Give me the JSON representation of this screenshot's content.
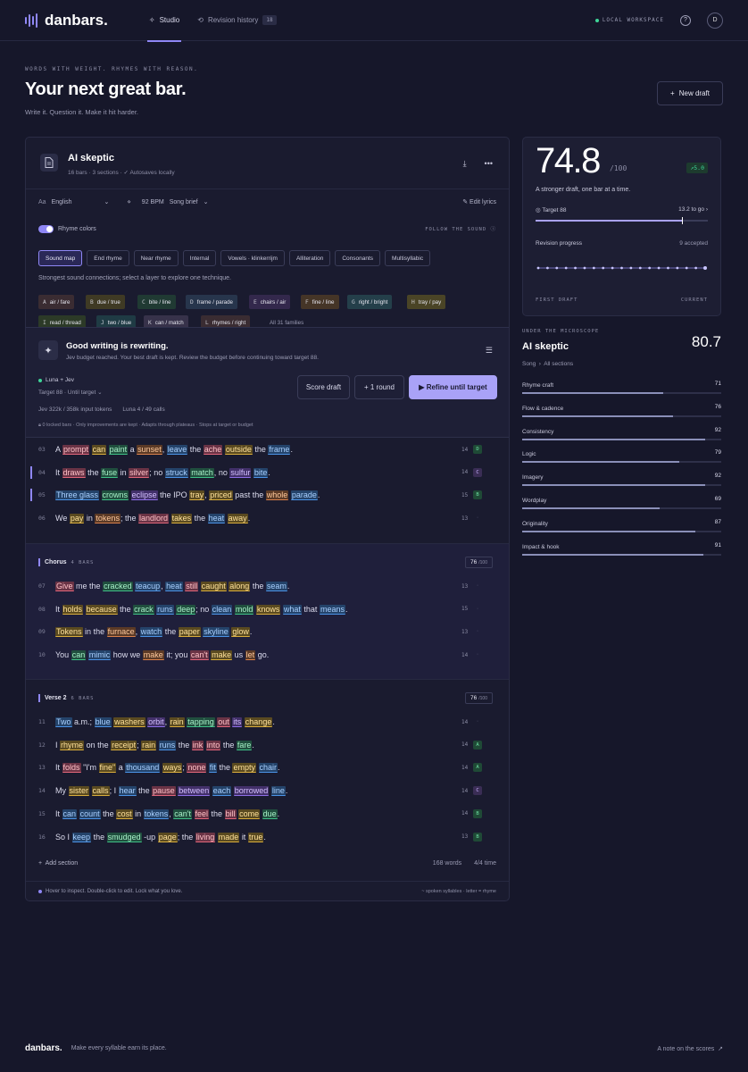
{
  "nav": {
    "logo": "danbars.",
    "tabs": [
      {
        "label": "Studio"
      },
      {
        "label": "Revision history",
        "count": "18"
      }
    ],
    "workspace": "LOCAL WORKSPACE",
    "help": "?",
    "avatar": "D"
  },
  "hero": {
    "eyebrow": "WORDS WITH WEIGHT. RHYMES WITH REASON.",
    "title": "Your next great bar.",
    "subtitle": "Write it. Question it. Make it hit harder.",
    "new_draft": "New draft"
  },
  "editor": {
    "title": "AI skeptic",
    "meta_bars": "16 bars",
    "meta_sections": "3 sections",
    "meta_save": "Autosaves locally",
    "language_label": "Aa",
    "language": "English",
    "bpm": "92 BPM",
    "brief": "Song brief",
    "edit_lyrics": "Edit lyrics",
    "rhyme_colors": "Rhyme colors",
    "follow": "FOLLOW THE SOUND",
    "chips": [
      "Sound map",
      "End rhyme",
      "Near rhyme",
      "Internal",
      "Vowels · klinkerrijm",
      "Alliteration",
      "Consonants",
      "Multisyllabic"
    ],
    "chip_hint": "Strongest sound connections; select a layer to explore one technique.",
    "families": [
      {
        "key": "A",
        "label": "air / fare"
      },
      {
        "key": "B",
        "label": "due / true"
      },
      {
        "key": "C",
        "label": "bite / line"
      },
      {
        "key": "D",
        "label": "frame / parade"
      },
      {
        "key": "E",
        "label": "chairs / air"
      },
      {
        "key": "F",
        "label": "fine / line"
      },
      {
        "key": "G",
        "label": "right / bright"
      },
      {
        "key": "H",
        "label": "tray / pay"
      },
      {
        "key": "I",
        "label": "read / thread"
      },
      {
        "key": "J",
        "label": "two / blue"
      },
      {
        "key": "K",
        "label": "can / match"
      },
      {
        "key": "L",
        "label": "rhymes / right"
      }
    ],
    "families_all": "All 31 families"
  },
  "panel": {
    "title": "Good writing is rewriting.",
    "subtitle": "Jev budget reached. Your best draft is kept. Review the budget before continuing toward target 88.",
    "model": "Luna + Jev",
    "target": "Target 88",
    "until": "Until target",
    "tokens": "Jev 322k / 358k input tokens",
    "calls": "Luna 4 / 49 calls",
    "locks": "0 locked bars",
    "rule1": "Only improvements are kept",
    "rule2": "Adapts through plateaus · Stops at target or budget",
    "score_btn": "Score draft",
    "round_btn": "1 round",
    "refine_btn": "Refine until target"
  },
  "verse1": [
    {
      "n": "03",
      "syl": "14",
      "scheme": "D",
      "words": [
        [
          "A",
          -1
        ],
        [
          "prompt",
          0
        ],
        [
          "can",
          1
        ],
        [
          "paint",
          2
        ],
        [
          "a",
          -1
        ],
        [
          "sunset",
          5
        ],
        [
          ",",
          -1
        ],
        [
          "leave",
          3
        ],
        [
          "the",
          -1
        ],
        [
          "ache",
          0
        ],
        [
          "outside",
          1
        ],
        [
          "the",
          -1
        ],
        [
          "frame",
          3
        ],
        [
          ".",
          -1
        ]
      ]
    },
    {
      "n": "04",
      "syl": "14",
      "scheme": "C",
      "mark": true,
      "words": [
        [
          "It",
          -1
        ],
        [
          "draws",
          0
        ],
        [
          "the",
          -1
        ],
        [
          "fuse",
          2
        ],
        [
          "in",
          -1
        ],
        [
          "silver",
          0
        ],
        [
          ";",
          -1
        ],
        [
          "no",
          -1
        ],
        [
          "struck",
          3
        ],
        [
          "match",
          2
        ],
        [
          ",",
          -1
        ],
        [
          "no",
          -1
        ],
        [
          "sulfur",
          4
        ],
        [
          "bite",
          3
        ],
        [
          ".",
          -1
        ]
      ]
    },
    {
      "n": "05",
      "syl": "15",
      "scheme": "B",
      "mark": true,
      "words": [
        [
          "Three glass",
          3
        ],
        [
          "crowns",
          2
        ],
        [
          "eclipse",
          4
        ],
        [
          "the IPO",
          -1
        ],
        [
          "tray",
          1
        ],
        [
          ",",
          -1
        ],
        [
          "priced",
          1
        ],
        [
          "past",
          -1
        ],
        [
          "the",
          -1
        ],
        [
          "whole",
          5
        ],
        [
          "parade",
          3
        ],
        [
          ".",
          -1
        ]
      ]
    },
    {
      "n": "06",
      "syl": "13",
      "scheme": "",
      "words": [
        [
          "We",
          -1
        ],
        [
          "pay",
          1
        ],
        [
          "in",
          -1
        ],
        [
          "tokens",
          5
        ],
        [
          ";",
          -1
        ],
        [
          "the",
          -1
        ],
        [
          "landlord",
          0
        ],
        [
          "takes",
          1
        ],
        [
          "the",
          -1
        ],
        [
          "heat",
          3
        ],
        [
          "away",
          1
        ],
        [
          ".",
          -1
        ]
      ]
    }
  ],
  "chorus": {
    "name": "Chorus",
    "count": "4 BARS",
    "score": "76",
    "max": "/100",
    "bars": [
      {
        "n": "07",
        "syl": "13",
        "scheme": "",
        "words": [
          [
            "Give",
            0
          ],
          [
            "me the",
            -1
          ],
          [
            "cracked",
            2
          ],
          [
            "teacup",
            3
          ],
          [
            ",",
            -1
          ],
          [
            "heat",
            3
          ],
          [
            "still",
            0
          ],
          [
            "caught",
            1
          ],
          [
            "along",
            1
          ],
          [
            "the",
            -1
          ],
          [
            "seam",
            3
          ],
          [
            ".",
            -1
          ]
        ]
      },
      {
        "n": "08",
        "syl": "15",
        "scheme": "",
        "words": [
          [
            "It",
            -1
          ],
          [
            "holds",
            1
          ],
          [
            "because",
            1
          ],
          [
            "the",
            -1
          ],
          [
            "crack",
            2
          ],
          [
            "runs",
            3
          ],
          [
            "deep",
            2
          ],
          [
            ";",
            -1
          ],
          [
            "no",
            -1
          ],
          [
            "clean",
            3
          ],
          [
            "mold",
            2
          ],
          [
            "knows",
            1
          ],
          [
            "what",
            3
          ],
          [
            "that",
            -1
          ],
          [
            "means",
            3
          ],
          [
            ".",
            -1
          ]
        ]
      },
      {
        "n": "09",
        "syl": "13",
        "scheme": "",
        "words": [
          [
            "Tokens",
            1
          ],
          [
            "in",
            -1
          ],
          [
            "the",
            -1
          ],
          [
            "furnace",
            5
          ],
          [
            ",",
            -1
          ],
          [
            "watch",
            3
          ],
          [
            "the",
            -1
          ],
          [
            "paper",
            1
          ],
          [
            "skyline",
            3
          ],
          [
            "glow",
            1
          ],
          [
            ".",
            -1
          ]
        ]
      },
      {
        "n": "10",
        "syl": "14",
        "scheme": "",
        "words": [
          [
            "You",
            -1
          ],
          [
            "can",
            2
          ],
          [
            "mimic",
            3
          ],
          [
            "how we",
            -1
          ],
          [
            "make",
            5
          ],
          [
            "it; you",
            -1
          ],
          [
            "can't",
            0
          ],
          [
            "make",
            1
          ],
          [
            "us",
            -1
          ],
          [
            "let",
            5
          ],
          [
            "go.",
            -1
          ]
        ]
      }
    ]
  },
  "verse2": {
    "name": "Verse 2",
    "count": "6 BARS",
    "score": "76",
    "max": "/100",
    "bars": [
      {
        "n": "11",
        "syl": "14",
        "scheme": "",
        "words": [
          [
            "Two",
            3
          ],
          [
            "a.m.;",
            -1
          ],
          [
            "blue",
            3
          ],
          [
            "washers",
            1
          ],
          [
            "orbit",
            4
          ],
          [
            ",",
            -1
          ],
          [
            "rain",
            1
          ],
          [
            "tapping",
            2
          ],
          [
            "out",
            0
          ],
          [
            "its",
            4
          ],
          [
            "change",
            1
          ],
          [
            ".",
            -1
          ]
        ]
      },
      {
        "n": "12",
        "syl": "14",
        "scheme": "A",
        "words": [
          [
            "I",
            -1
          ],
          [
            "rhyme",
            1
          ],
          [
            "on the",
            -1
          ],
          [
            "receipt",
            1
          ],
          [
            ";",
            -1
          ],
          [
            "rain",
            1
          ],
          [
            "runs",
            3
          ],
          [
            "the",
            -1
          ],
          [
            "ink",
            0
          ],
          [
            "into",
            0
          ],
          [
            "the",
            -1
          ],
          [
            "fare",
            2
          ],
          [
            ".",
            -1
          ]
        ]
      },
      {
        "n": "13",
        "syl": "14",
        "scheme": "A",
        "words": [
          [
            "It",
            -1
          ],
          [
            "folds",
            0
          ],
          [
            "\"I'm",
            -1
          ],
          [
            "fine\"",
            1
          ],
          [
            "a",
            -1
          ],
          [
            "thousand",
            3
          ],
          [
            "ways",
            1
          ],
          [
            ";",
            -1
          ],
          [
            "none",
            0
          ],
          [
            "fit",
            3
          ],
          [
            "the",
            -1
          ],
          [
            "empty",
            1
          ],
          [
            "chair",
            3
          ],
          [
            ".",
            -1
          ]
        ]
      },
      {
        "n": "14",
        "syl": "14",
        "scheme": "C",
        "words": [
          [
            "My",
            -1
          ],
          [
            "sister",
            1
          ],
          [
            "calls",
            1
          ],
          [
            "; I",
            -1
          ],
          [
            "hear",
            3
          ],
          [
            "the",
            -1
          ],
          [
            "pause",
            0
          ],
          [
            "between",
            4
          ],
          [
            "each",
            3
          ],
          [
            "borrowed",
            4
          ],
          [
            "line",
            3
          ],
          [
            ".",
            -1
          ]
        ]
      },
      {
        "n": "15",
        "syl": "14",
        "scheme": "B",
        "words": [
          [
            "It",
            -1
          ],
          [
            "can",
            3
          ],
          [
            "count",
            3
          ],
          [
            "the",
            -1
          ],
          [
            "cost",
            1
          ],
          [
            "in",
            -1
          ],
          [
            "tokens",
            3
          ],
          [
            ",",
            -1
          ],
          [
            "can't",
            2
          ],
          [
            "feel",
            0
          ],
          [
            "the",
            -1
          ],
          [
            "bill",
            0
          ],
          [
            "come",
            1
          ],
          [
            "due",
            2
          ],
          [
            ".",
            -1
          ]
        ]
      },
      {
        "n": "16",
        "syl": "13",
        "scheme": "B",
        "words": [
          [
            "So I",
            -1
          ],
          [
            "keep",
            3
          ],
          [
            "the",
            -1
          ],
          [
            "smudged",
            2
          ],
          [
            "-up",
            -1
          ],
          [
            "page",
            1
          ],
          [
            "; the",
            -1
          ],
          [
            "living",
            0
          ],
          [
            "made",
            1
          ],
          [
            "it",
            -1
          ],
          [
            "true",
            1
          ],
          [
            ".",
            -1
          ]
        ]
      }
    ]
  },
  "footer_bar": {
    "add_section": "Add section",
    "words": "168 words",
    "time": "4/4 time",
    "hint": "Hover to inspect. Double-click to edit. Lock what you love.",
    "legend1": "~ spoken syllables",
    "legend2": "letter = rhyme"
  },
  "scorecard": {
    "score": "74.8",
    "max": "/100",
    "delta": "5.0",
    "subtitle": "A stronger draft, one bar at a time.",
    "target": "Target 88",
    "to_go": "13.2 to go",
    "progress_fraction": 0.85,
    "revision_label": "Revision progress",
    "accepted": "9 accepted",
    "history_points": 19,
    "first": "FIRST DRAFT",
    "current": "CURRENT"
  },
  "micro": {
    "eyebrow": "UNDER THE MICROSCOPE",
    "title": "AI skeptic",
    "score": "80.7",
    "crumb_a": "Song",
    "crumb_b": "All sections",
    "metrics": [
      {
        "label": "Rhyme craft",
        "value": "71"
      },
      {
        "label": "Flow & cadence",
        "value": "76"
      },
      {
        "label": "Consistency",
        "value": "92"
      },
      {
        "label": "Logic",
        "value": "79"
      },
      {
        "label": "Imagery",
        "value": "92"
      },
      {
        "label": "Wordplay",
        "value": "69"
      },
      {
        "label": "Originality",
        "value": "87"
      },
      {
        "label": "Impact & hook",
        "value": "91"
      }
    ]
  },
  "page_footer": {
    "logo": "danbars.",
    "tagline": "Make every syllable earn its place.",
    "link": "A note on the scores"
  },
  "colors": {
    "accent": "#8f87f5",
    "positive": "#3ed598",
    "background": "#16172a"
  }
}
